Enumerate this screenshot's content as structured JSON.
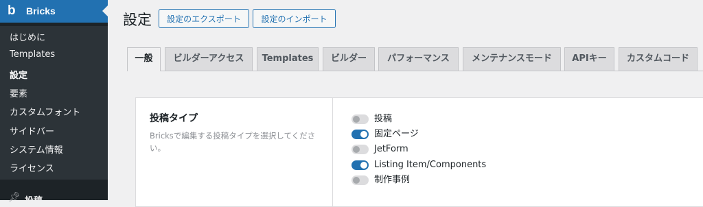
{
  "sidebar": {
    "brand_logo": "b",
    "brand_label": "Bricks",
    "items": [
      {
        "label": "はじめに",
        "current": false
      },
      {
        "label": "Templates",
        "current": false
      },
      {
        "label": "設定",
        "current": true
      },
      {
        "label": "要素",
        "current": false
      },
      {
        "label": "カスタムフォント",
        "current": false
      },
      {
        "label": "サイドバー",
        "current": false
      },
      {
        "label": "システム情報",
        "current": false
      },
      {
        "label": "ライセンス",
        "current": false
      }
    ],
    "next_menu": {
      "label": "投稿",
      "icon": "pin-icon"
    }
  },
  "header": {
    "title": "設定",
    "export_label": "設定のエクスポート",
    "import_label": "設定のインポート"
  },
  "tabs": [
    {
      "label": "一般",
      "active": true
    },
    {
      "label": "ビルダーアクセス",
      "active": false
    },
    {
      "label": "Templates",
      "active": false
    },
    {
      "label": "ビルダー",
      "active": false
    },
    {
      "label": "パフォーマンス",
      "active": false
    },
    {
      "label": "メンテナンスモード",
      "active": false
    },
    {
      "label": "APIキー",
      "active": false
    },
    {
      "label": "カスタムコード",
      "active": false
    }
  ],
  "post_types": {
    "title": "投稿タイプ",
    "description": "Bricksで編集する投稿タイプを選択してください。",
    "options": [
      {
        "label": "投稿",
        "enabled": false
      },
      {
        "label": "固定ページ",
        "enabled": true
      },
      {
        "label": "JetForm",
        "enabled": false
      },
      {
        "label": "Listing Item/Components",
        "enabled": true
      },
      {
        "label": "制作事例",
        "enabled": false
      }
    ]
  },
  "colors": {
    "accent": "#2271b1",
    "sidebar_bg": "#1d2327",
    "submenu_bg": "#2c3338",
    "page_bg": "#f0f0f1"
  }
}
